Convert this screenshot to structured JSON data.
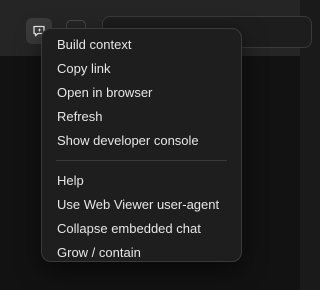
{
  "menu": {
    "group1": [
      {
        "label": "Build context"
      },
      {
        "label": "Copy link"
      },
      {
        "label": "Open in browser"
      },
      {
        "label": "Refresh"
      },
      {
        "label": "Show developer console"
      }
    ],
    "group2": [
      {
        "label": "Help"
      },
      {
        "label": "Use Web Viewer user-agent"
      },
      {
        "label": "Collapse embedded chat"
      },
      {
        "label": "Grow / contain"
      }
    ]
  },
  "icons": {
    "active": "chat-sparkle-icon",
    "secondary": "square-icon"
  },
  "colors": {
    "background": "#1a1a1a",
    "menu_background": "#1e1e1e",
    "menu_text": "#e6e6e6",
    "border": "#3a3a3a"
  }
}
